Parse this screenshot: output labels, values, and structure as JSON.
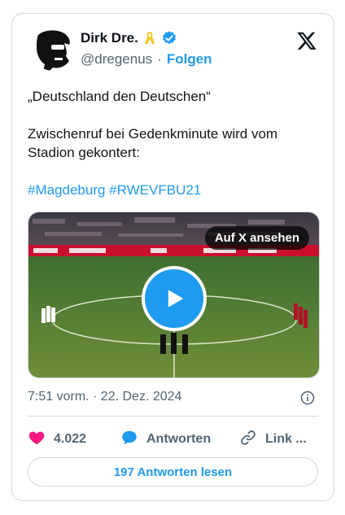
{
  "author": {
    "name": "Dirk Dre.",
    "handle": "@dregenus",
    "separator": "·",
    "follow_label": "Folgen"
  },
  "icons": {
    "brand": "x-logo-icon",
    "verified": "verified-badge-icon",
    "ribbon": "yellow-ribbon-icon",
    "play": "play-icon",
    "info": "info-icon",
    "like": "heart-icon",
    "reply": "speech-bubble-icon",
    "link": "link-icon"
  },
  "colors": {
    "accent": "#1d9bf0",
    "like": "#f91880",
    "ribbon": "#f5c518"
  },
  "tweet": {
    "quote_line": "„Deutschland den Deutschen“",
    "body_line": "Zwischenruf bei Gedenkminute wird vom Stadion gekontert:",
    "hashtags": [
      "#Magdeburg",
      "#RWEVFBU21"
    ]
  },
  "media": {
    "watch_label": "Auf X ansehen"
  },
  "meta": {
    "timestamp": "7:51 vorm. · 22. Dez. 2024"
  },
  "actions": {
    "likes": "4.022",
    "reply_label": "Antworten",
    "link_label": "Link ..."
  },
  "footer": {
    "read_replies_label": "197 Antworten lesen"
  }
}
